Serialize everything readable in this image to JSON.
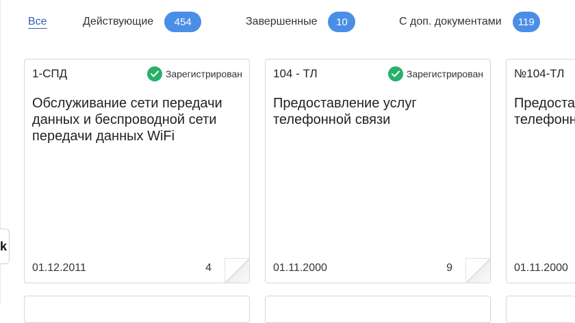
{
  "tabs": [
    {
      "label": "Все",
      "active": true
    },
    {
      "label": "Действующие",
      "count": "454"
    },
    {
      "label": "Завершенные",
      "count": "10"
    },
    {
      "label": "С доп. документами",
      "count": "119"
    }
  ],
  "cards": [
    {
      "code": "1-СПД",
      "status": "Зарегистрирован",
      "status_icon": "check-circle-icon",
      "title": "Обслуживание сети передачи данных и беспроводной сети передачи данных WiFi",
      "date": "01.12.2011",
      "count": "4"
    },
    {
      "code": "104 - ТЛ",
      "status": "Зарегистрирован",
      "status_icon": "check-circle-icon",
      "title": "Предоставление услуг телефонной связи",
      "date": "01.11.2000",
      "count": "9"
    },
    {
      "code": "№104-ТЛ",
      "title": "Предоставление услуг телефонной связи",
      "date": "01.11.2000"
    }
  ],
  "side_control": {
    "glyph": "k",
    "icon": "chevron-left-icon"
  },
  "colors": {
    "accent": "#2f5fb3",
    "badge": "#4a8ee6",
    "success": "#27b06a",
    "border": "#d6d6d6"
  }
}
